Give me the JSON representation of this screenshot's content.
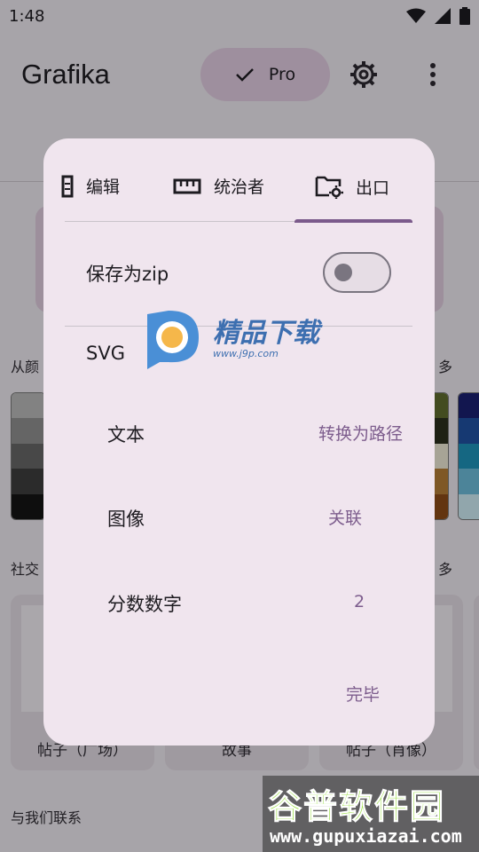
{
  "status": {
    "time": "1:48"
  },
  "app": {
    "title": "Grafika",
    "pro_label": "Pro"
  },
  "background": {
    "section_colors_label": "从颜",
    "section_colors_more": "多",
    "section_social_label": "社交",
    "section_social_more": "多",
    "social_cards": [
      "帖子（广场）",
      "故事",
      "帖子（肖像）"
    ],
    "contact_label": "与我们联系"
  },
  "dialog": {
    "tabs": [
      {
        "label": "编辑",
        "icon": "edit-document-icon"
      },
      {
        "label": "统治者",
        "icon": "ruler-icon"
      },
      {
        "label": "出口",
        "icon": "folder-settings-icon",
        "selected": true
      }
    ],
    "save_zip_label": "保存为zip",
    "save_zip_enabled": false,
    "svg_label": "SVG",
    "rows": [
      {
        "label": "文本",
        "value": "转换为路径"
      },
      {
        "label": "图像",
        "value": "关联"
      },
      {
        "label": "分数数字",
        "value": "2"
      }
    ],
    "done_label": "完毕"
  },
  "watermarks": {
    "top_title": "精品下载",
    "top_url": "www.j9p.com",
    "bottom_title": "谷普软件园",
    "bottom_url": "www.gupuxiazai.com"
  },
  "colors": {
    "accent": "#7b5a8b",
    "dialog_bg": "#f0e5ee",
    "value_text": "#7d5d8d"
  }
}
